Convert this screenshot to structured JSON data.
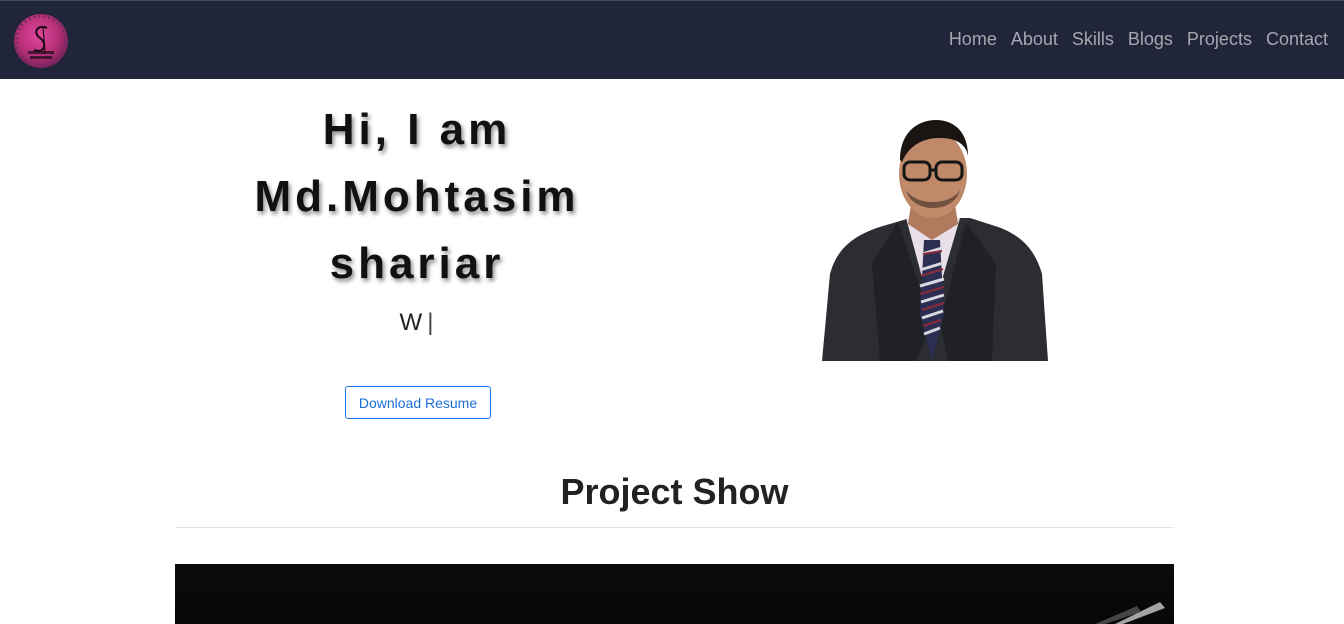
{
  "navbar": {
    "logo_icon": "studio-logo-icon",
    "links": [
      {
        "label": "Home"
      },
      {
        "label": "About"
      },
      {
        "label": "Skills"
      },
      {
        "label": "Blogs"
      },
      {
        "label": "Projects"
      },
      {
        "label": "Contact"
      }
    ]
  },
  "hero": {
    "title_line1": "Hi, I am",
    "title_line2": "Md.Mohtasim",
    "title_line3": "shariar",
    "typed_text": "W",
    "cursor": "|",
    "download_label": "Download Resume",
    "portrait_icon": "person-portrait-photo"
  },
  "projects": {
    "section_title": "Project Show"
  },
  "colors": {
    "navbar_bg": "#212539",
    "nav_link": "#a6a6ae",
    "button_accent": "#1a73e8"
  }
}
